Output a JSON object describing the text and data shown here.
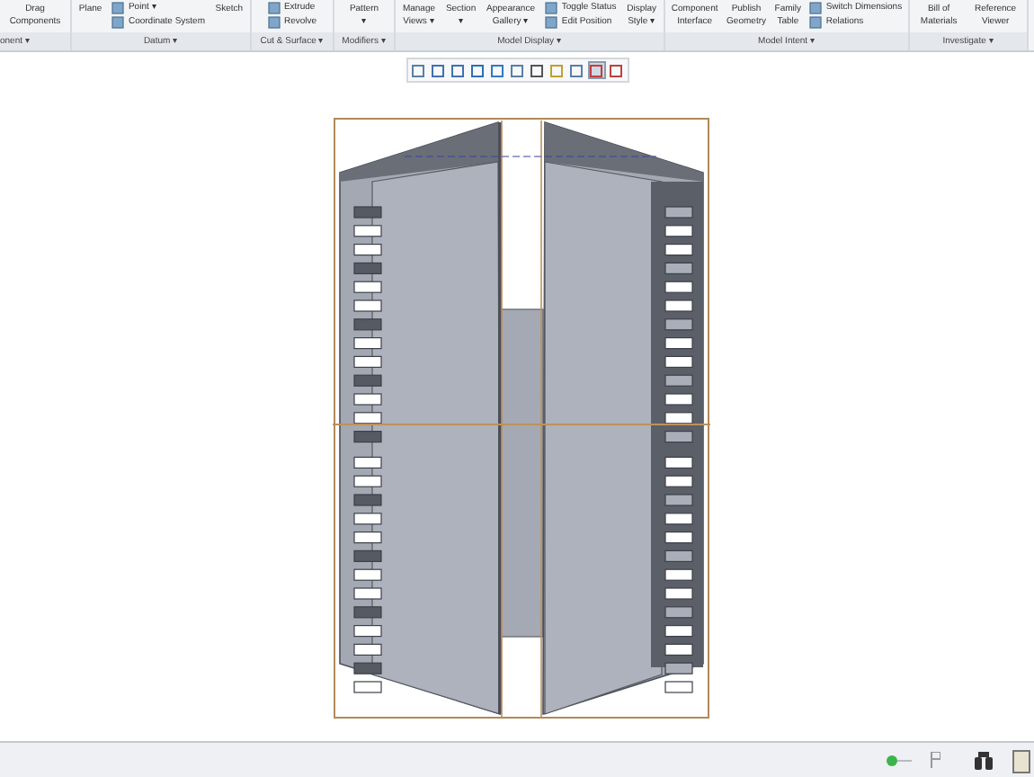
{
  "ribbon": {
    "groups": [
      {
        "label": "onent ▾",
        "items": [
          {
            "kind": "large",
            "label": "Drag Components"
          }
        ]
      },
      {
        "label": "Datum ▾",
        "items": [
          {
            "kind": "large",
            "label": "Plane"
          },
          {
            "kind": "stack",
            "items": [
              "Point ▾",
              "Coordinate System"
            ]
          },
          {
            "kind": "large",
            "label": "Sketch"
          }
        ]
      },
      {
        "label": "Cut & Surface ▾",
        "items": [
          {
            "kind": "stack",
            "items": [
              "Extrude",
              "Revolve"
            ]
          }
        ]
      },
      {
        "label": "Modifiers ▾",
        "items": [
          {
            "kind": "large",
            "label": "Pattern ▾"
          }
        ]
      },
      {
        "label": "Model Display ▾",
        "items": [
          {
            "kind": "large",
            "label": "Manage Views ▾"
          },
          {
            "kind": "large",
            "label": "Section ▾"
          },
          {
            "kind": "large",
            "label": "Appearance Gallery ▾"
          },
          {
            "kind": "stack",
            "items": [
              "Toggle Status",
              "Edit Position"
            ]
          },
          {
            "kind": "large",
            "label": "Display Style ▾"
          }
        ]
      },
      {
        "label": "Model Intent ▾",
        "items": [
          {
            "kind": "large",
            "label": "Component Interface"
          },
          {
            "kind": "large",
            "label": "Publish Geometry"
          },
          {
            "kind": "large",
            "label": "Family Table"
          },
          {
            "kind": "stack",
            "items": [
              "Switch Dimensions",
              "Relations"
            ]
          }
        ]
      },
      {
        "label": "Investigate ▾",
        "items": [
          {
            "kind": "large",
            "label": "Bill of Materials"
          },
          {
            "kind": "large",
            "label": "Reference Viewer"
          }
        ]
      }
    ]
  },
  "view_toolbar": [
    {
      "selected": false
    },
    {
      "selected": false
    },
    {
      "selected": false
    },
    {
      "selected": false
    },
    {
      "selected": false
    },
    {
      "selected": false
    },
    {
      "selected": false
    },
    {
      "selected": false
    },
    {
      "selected": false
    },
    {
      "selected": true
    },
    {
      "selected": false
    }
  ]
}
